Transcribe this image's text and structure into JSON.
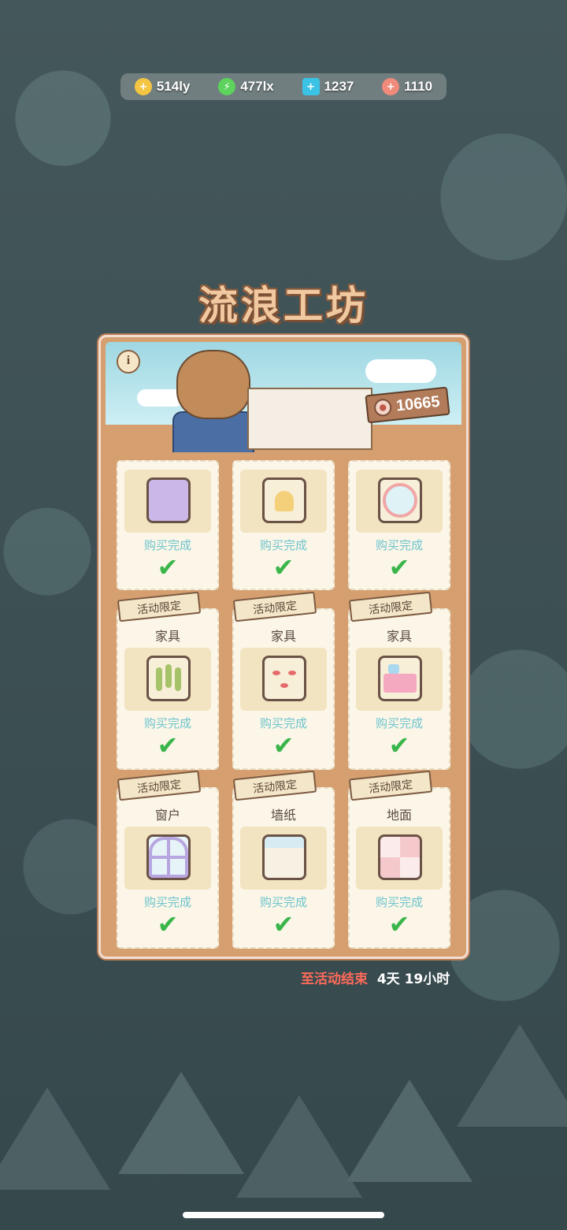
{
  "resources": [
    {
      "icon": "coin-icon",
      "value": "514ly",
      "color": "#f4c542"
    },
    {
      "icon": "energy-icon",
      "value": "477lx",
      "color": "#5dd35d"
    },
    {
      "icon": "gem-icon",
      "value": "1237",
      "color": "#3bc3e6"
    },
    {
      "icon": "shell-icon",
      "value": "1110",
      "color": "#f08a7a"
    }
  ],
  "title": "流浪工坊",
  "banner": {
    "info_label": "i",
    "score": "10665"
  },
  "items": [
    {
      "tag": "",
      "category": "",
      "status": "购买完成",
      "thumb": "wardrobe",
      "color": "#cbb8e8"
    },
    {
      "tag": "",
      "category": "",
      "status": "购买完成",
      "thumb": "bell",
      "color": "#f3d079"
    },
    {
      "tag": "",
      "category": "",
      "status": "购买完成",
      "thumb": "mirror",
      "color": "#f0a6a6"
    },
    {
      "tag": "活动限定",
      "category": "家具",
      "status": "购买完成",
      "thumb": "plant",
      "color": "#a6c36a"
    },
    {
      "tag": "活动限定",
      "category": "家具",
      "status": "购买完成",
      "thumb": "wall-decor",
      "color": "#e56b6b"
    },
    {
      "tag": "活动限定",
      "category": "家具",
      "status": "购买完成",
      "thumb": "sink",
      "color": "#f4a9c0"
    },
    {
      "tag": "活动限定",
      "category": "窗户",
      "status": "购买完成",
      "thumb": "window",
      "color": "#b8a6e0"
    },
    {
      "tag": "活动限定",
      "category": "墙纸",
      "status": "购买完成",
      "thumb": "wallpaper",
      "color": "#d6ecf2"
    },
    {
      "tag": "活动限定",
      "category": "地面",
      "status": "购买完成",
      "thumb": "floor",
      "color": "#f5c9cc"
    }
  ],
  "timer": {
    "label": "至活动结束",
    "value": "4天 19小时"
  }
}
